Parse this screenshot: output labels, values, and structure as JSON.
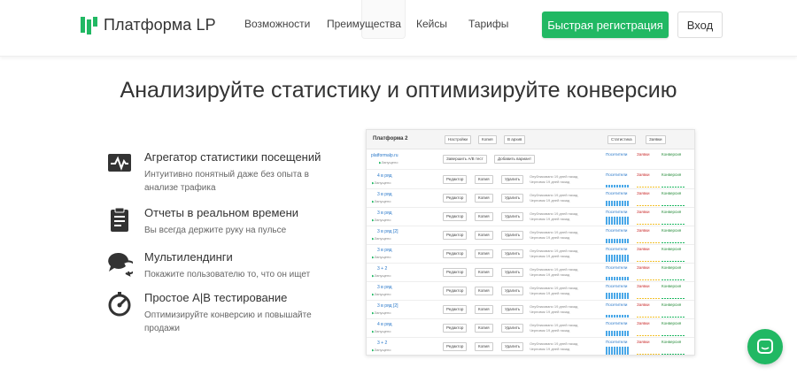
{
  "header": {
    "logo_text": "Платформа LP",
    "nav": [
      "Возможности",
      "Преимущества",
      "Кейсы",
      "Тарифы"
    ],
    "register_label": "Быстрая регистрация",
    "login_label": "Вход"
  },
  "headline": "Анализируйте статистику и оптимизируйте конверсию",
  "features": [
    {
      "icon": "pulse-monitor-icon",
      "title": "Агрегатор статистики посещений",
      "desc": "Интуитивно понятный даже без опыта в анализе трафика"
    },
    {
      "icon": "clipboard-icon",
      "title": "Отчеты в реальном времени",
      "desc": "Вы всегда держите руку на пульсе"
    },
    {
      "icon": "chat-bubbles-icon",
      "title": "Мультилендинги",
      "desc": "Покажите пользователю то, что он ищет"
    },
    {
      "icon": "gauge-icon",
      "title": "Простое A|B тестирование",
      "desc": "Оптимизируйте конверсию и повышайте продажи"
    }
  ],
  "mockup": {
    "title": "Платформа 2",
    "top_buttons": [
      "Настройки",
      "Копия",
      "В архив"
    ],
    "right_buttons": [
      "Статистика",
      "Заявки"
    ],
    "site": "platformalp.ru",
    "site_status": "Запущено",
    "ab_button": "Завершить A/B тест",
    "add_variant": "Добавить вариант",
    "head_cols": [
      "Посетители",
      "Заявки",
      "Конверсия"
    ],
    "row_actions": [
      "Редактор",
      "Копия",
      "Удалить"
    ],
    "published": "Опубликовано 19 дней назад",
    "draft": "Черновик 19 дней назад",
    "status": "Запущено",
    "rows": [
      "4 в ряд",
      "3 в ряд",
      "3 в ряд",
      "3 в ряд [2]",
      "3 в ряд",
      "3 + 2",
      "3 в ряд",
      "3 в ряд [2]",
      "4 в ряд",
      "3 + 2",
      "3 в ряд"
    ],
    "row_cols": [
      "Посетители",
      "Заявки",
      "Конверсия"
    ]
  },
  "colors": {
    "accent": "#21b863",
    "link": "#2a78c9",
    "bar_blue": "#4aa8e8",
    "bar_yellow": "#f2c230"
  }
}
